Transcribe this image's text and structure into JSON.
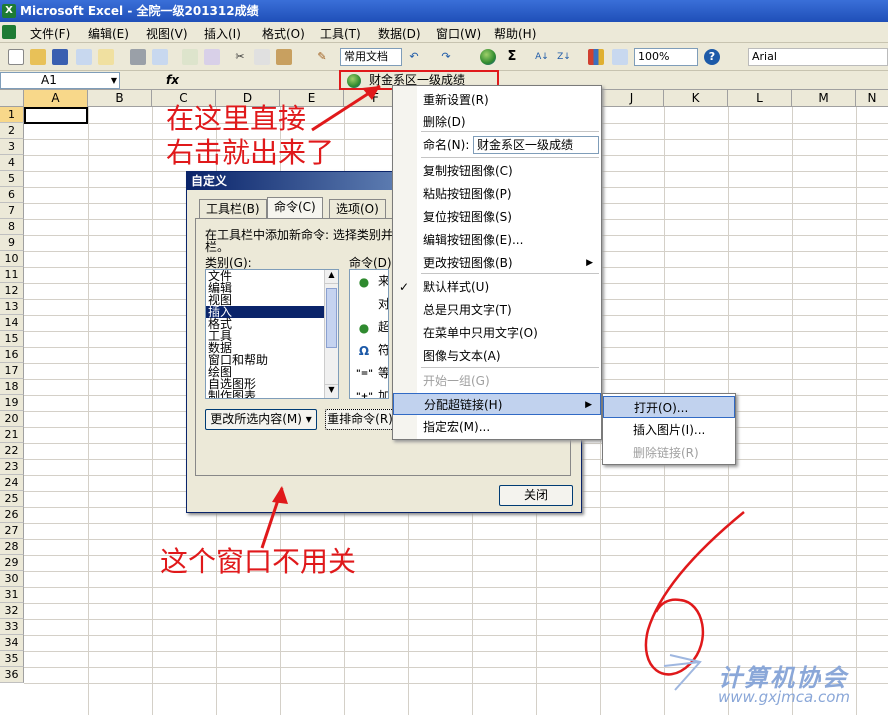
{
  "window": {
    "title": "Microsoft Excel - 全院一级201312成绩"
  },
  "menubar": [
    "文件(F)",
    "编辑(E)",
    "视图(V)",
    "插入(I)",
    "格式(O)",
    "工具(T)",
    "数据(D)",
    "窗口(W)",
    "帮助(H)"
  ],
  "toolbar": {
    "custom_doc": "常用文档",
    "zoom": "100%",
    "font": "Arial",
    "sigma": "Σ"
  },
  "formula_bar": {
    "namebox": "A1",
    "fx": "fx"
  },
  "sheet": {
    "columns": [
      "A",
      "B",
      "C",
      "D",
      "E",
      "F",
      "G",
      "H",
      "I",
      "J",
      "K",
      "L",
      "M",
      "N"
    ],
    "rows": [
      "1",
      "2",
      "3",
      "4",
      "5",
      "6",
      "7",
      "8",
      "9",
      "10",
      "11",
      "12",
      "13",
      "14",
      "15",
      "16",
      "17",
      "18",
      "19",
      "20",
      "21",
      "22",
      "23",
      "24",
      "25",
      "26",
      "27",
      "28",
      "29",
      "30",
      "31",
      "32",
      "33",
      "34",
      "35",
      "36"
    ]
  },
  "custom_button": {
    "label": "财金系区一级成绩"
  },
  "dialog": {
    "title": "自定义",
    "tabs": [
      "工具栏(B)",
      "命令(C)",
      "选项(O)"
    ],
    "instruction_line1": "在工具栏中添加新命令: 选择类别并",
    "instruction_line2": "栏。",
    "category_label": "类别(G):",
    "command_label": "命令(D)",
    "categories": [
      "文件",
      "编辑",
      "视图",
      "插入",
      "格式",
      "工具",
      "数据",
      "窗口和帮助",
      "绘图",
      "自选图形",
      "制作图表"
    ],
    "selected_category": "插入",
    "commands": [
      {
        "icon": "globe-icon",
        "text": "来"
      },
      {
        "icon": "blank-icon",
        "text": "对"
      },
      {
        "icon": "globe-icon",
        "text": "超"
      },
      {
        "icon": "omega-icon",
        "text": "符"
      },
      {
        "icon": "equals-icon",
        "text": "等"
      },
      {
        "icon": "plus-icon",
        "text": "加"
      }
    ],
    "modify_selection": "更改所选内容(M)",
    "rearrange": "重排命令(R)",
    "close": "关闭"
  },
  "context_menu": {
    "items": [
      {
        "label": "重新设置(R)"
      },
      {
        "label": "删除(D)"
      },
      {
        "label": "命名(N):",
        "value": "财金系区一级成绩"
      },
      {
        "label": "复制按钮图像(C)"
      },
      {
        "label": "粘贴按钮图像(P)"
      },
      {
        "label": "复位按钮图像(S)"
      },
      {
        "label": "编辑按钮图像(E)..."
      },
      {
        "label": "更改按钮图像(B)"
      },
      {
        "label": "默认样式(U)"
      },
      {
        "label": "总是只用文字(T)"
      },
      {
        "label": "在菜单中只用文字(O)"
      },
      {
        "label": "图像与文本(A)"
      },
      {
        "label": "开始一组(G)"
      },
      {
        "label": "分配超链接(H)"
      },
      {
        "label": "指定宏(M)..."
      }
    ]
  },
  "submenu": {
    "items": [
      "打开(O)...",
      "插入图片(I)...",
      "删除链接(R)"
    ]
  },
  "annotations": {
    "top_line1": "在这里直接",
    "top_line2": "右击就出来了",
    "bottom": "这个窗口不用关",
    "scribble": "6"
  },
  "watermark": {
    "text": "计算机协会",
    "url": "www.gxjmca.com"
  },
  "colors": {
    "annotation_red": "#e0191b",
    "selection_blue": "#0a246a",
    "menu_highlight": "#c1d2ee",
    "watermark": "#8aa7d8"
  }
}
